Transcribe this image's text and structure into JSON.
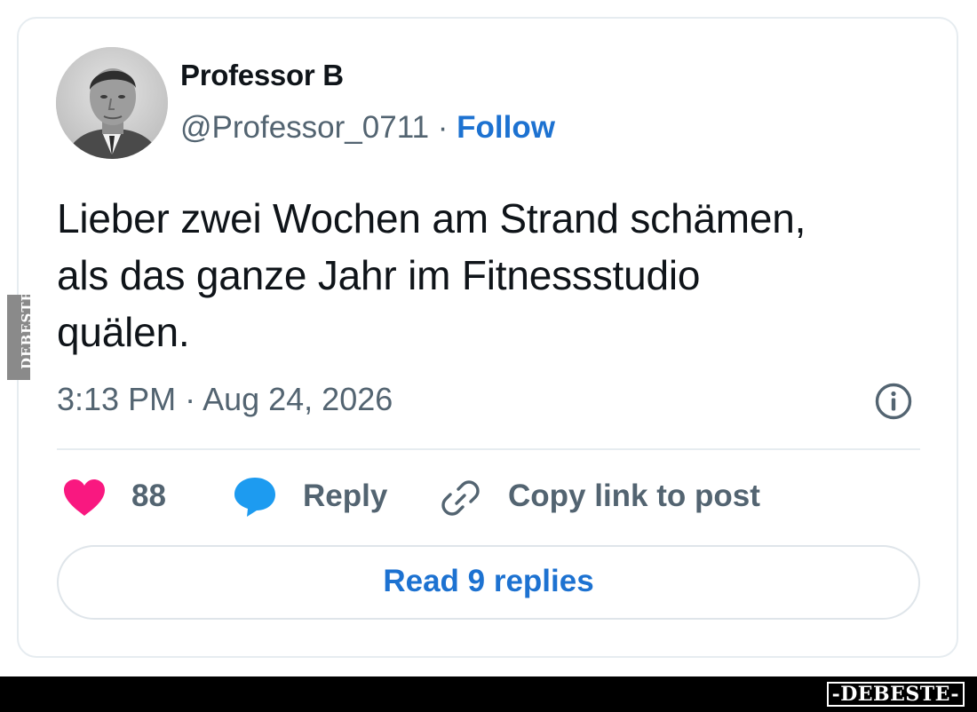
{
  "tweet": {
    "author": {
      "display_name": "Professor B",
      "handle": "@Professor_0711",
      "separator": " · ",
      "follow_label": "Follow",
      "avatar_icon": "avatar-photo"
    },
    "text_lines": [
      "Lieber zwei Wochen am Strand schämen,",
      "als das ganze Jahr im Fitnessstudio",
      "quälen."
    ],
    "timestamp": "3:13 PM · Aug 24, 2026",
    "info_icon": "info-icon",
    "actions": {
      "like": {
        "icon": "heart-icon",
        "count": "88",
        "color": "#f91880"
      },
      "reply": {
        "icon": "speech-bubble-icon",
        "label": "Reply",
        "color": "#1d9bf0"
      },
      "copy": {
        "icon": "link-icon",
        "label": "Copy link to post"
      }
    },
    "read_replies_label": "Read 9 replies"
  },
  "watermark": {
    "side_text": "DEBESTE",
    "footer_text": "-DEBESTE-"
  },
  "colors": {
    "link_blue": "#1d72d1",
    "text_primary": "#0f1419",
    "text_secondary": "#536471",
    "border": "#e6ecf0"
  }
}
